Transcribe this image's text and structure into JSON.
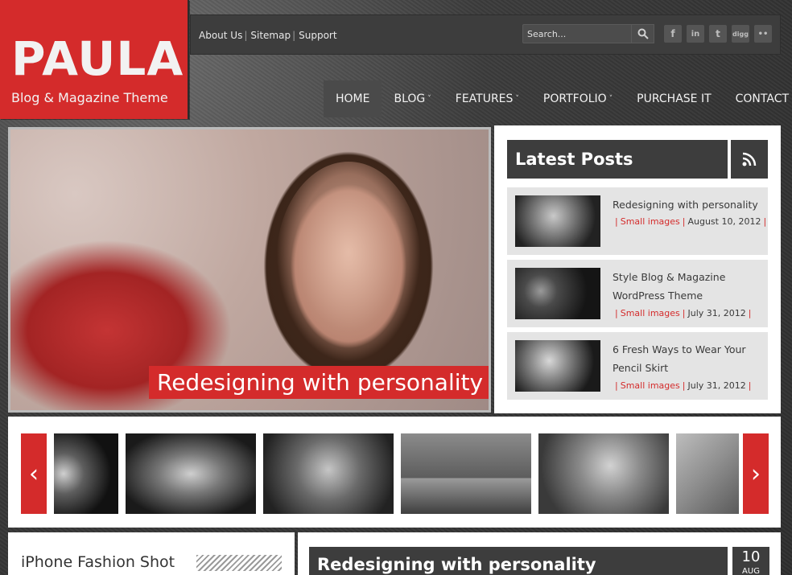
{
  "logo": {
    "title": "PAULA",
    "tagline": "Blog & Magazine Theme"
  },
  "top_links": [
    "About Us",
    "Sitemap",
    "Support"
  ],
  "search": {
    "placeholder": "Search..."
  },
  "social_icons": [
    "facebook-icon",
    "linkedin-icon",
    "twitter-icon",
    "digg-icon",
    "flickr-icon"
  ],
  "social_glyphs": {
    "facebook": "f",
    "linkedin": "in",
    "twitter": "t",
    "digg": "digg",
    "flickr": "••"
  },
  "nav": {
    "items": [
      {
        "label": "HOME",
        "active": true,
        "dropdown": false
      },
      {
        "label": "BLOG",
        "active": false,
        "dropdown": true
      },
      {
        "label": "FEATURES",
        "active": false,
        "dropdown": true
      },
      {
        "label": "PORTFOLIO",
        "active": false,
        "dropdown": true
      },
      {
        "label": "PURCHASE IT",
        "active": false,
        "dropdown": false
      },
      {
        "label": "CONTACT",
        "active": false,
        "dropdown": false
      }
    ],
    "caret": "˅"
  },
  "hero": {
    "caption": "Redesigning with personality"
  },
  "latest_posts": {
    "heading": "Latest Posts",
    "posts": [
      {
        "title": "Redesigning with personality",
        "category": "Small images",
        "date": "August 10, 2012"
      },
      {
        "title": "Style Blog & Magazine WordPress Theme",
        "category": "Small images",
        "date": "July 31, 2012"
      },
      {
        "title": "6 Fresh Ways to Wear Your Pencil Skirt",
        "category": "Small images",
        "date": "July 31, 2012"
      }
    ]
  },
  "carousel": {
    "prev_glyph": "‹",
    "next_glyph": "›"
  },
  "bottom": {
    "left_title": "iPhone Fashion Shot",
    "right_title": "Redesigning with personality",
    "date_day": "10",
    "date_month": "AUG"
  },
  "colors": {
    "accent": "#d42b2b",
    "dark_panel": "#3d3d3d",
    "light_panel": "#e4e4e4"
  }
}
